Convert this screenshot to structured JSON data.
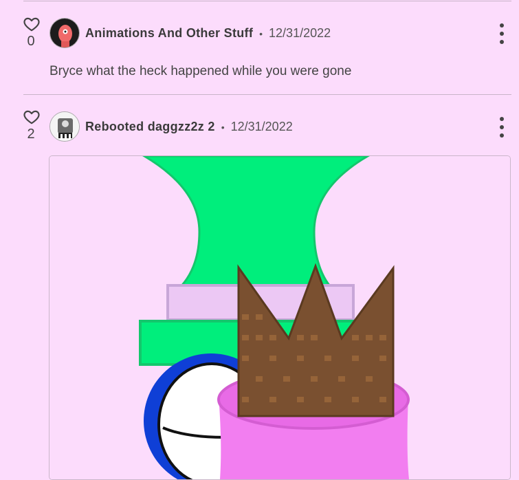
{
  "comments": [
    {
      "like_count": "0",
      "author": "Animations And Other Stuff",
      "separator": "•",
      "date": "12/31/2022",
      "text": "Bryce what the heck happened while you were gone"
    },
    {
      "like_count": "2",
      "author": "Rebooted daggzz2z 2",
      "separator": "•",
      "date": "12/31/2022"
    }
  ],
  "icons": {
    "like": "heart-outline-icon",
    "more": "more-vertical-icon"
  },
  "colors": {
    "background": "#fcdcfc",
    "divider": "#c8b4c8",
    "drawing_green": "#00ee7c",
    "drawing_lavender": "#ecc8f4",
    "drawing_brown": "#7a5030",
    "drawing_pink": "#f27ef0",
    "drawing_blue": "#0f3fd6"
  }
}
